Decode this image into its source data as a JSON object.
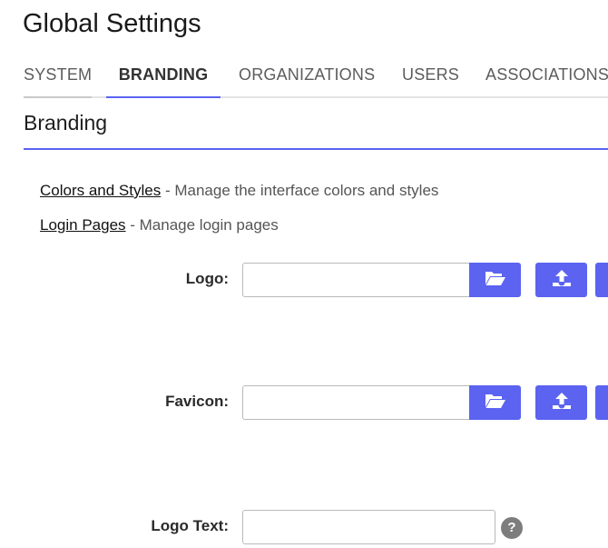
{
  "header": {
    "title": "Global Settings"
  },
  "tabs": [
    {
      "label": "SYSTEM"
    },
    {
      "label": "BRANDING",
      "active": true
    },
    {
      "label": "ORGANIZATIONS"
    },
    {
      "label": "USERS"
    },
    {
      "label": "ASSOCIATIONS"
    }
  ],
  "section": {
    "title": "Branding"
  },
  "links": [
    {
      "link_text": "Colors and Styles",
      "description": " - Manage the interface colors and styles"
    },
    {
      "link_text": "Login Pages",
      "description": " - Manage login pages"
    }
  ],
  "fields": {
    "logo": {
      "label": "Logo:",
      "value": "",
      "browse_icon": "folder-open-icon",
      "upload_icon": "upload-icon"
    },
    "favicon": {
      "label": "Favicon:",
      "value": "",
      "browse_icon": "folder-open-icon",
      "upload_icon": "upload-icon"
    },
    "logo_text": {
      "label": "Logo Text:",
      "value": "",
      "help_icon": "help-icon",
      "help_glyph": "?"
    }
  },
  "colors": {
    "accent": "#5b63f0",
    "tab_rule": "#e4e4e4"
  }
}
